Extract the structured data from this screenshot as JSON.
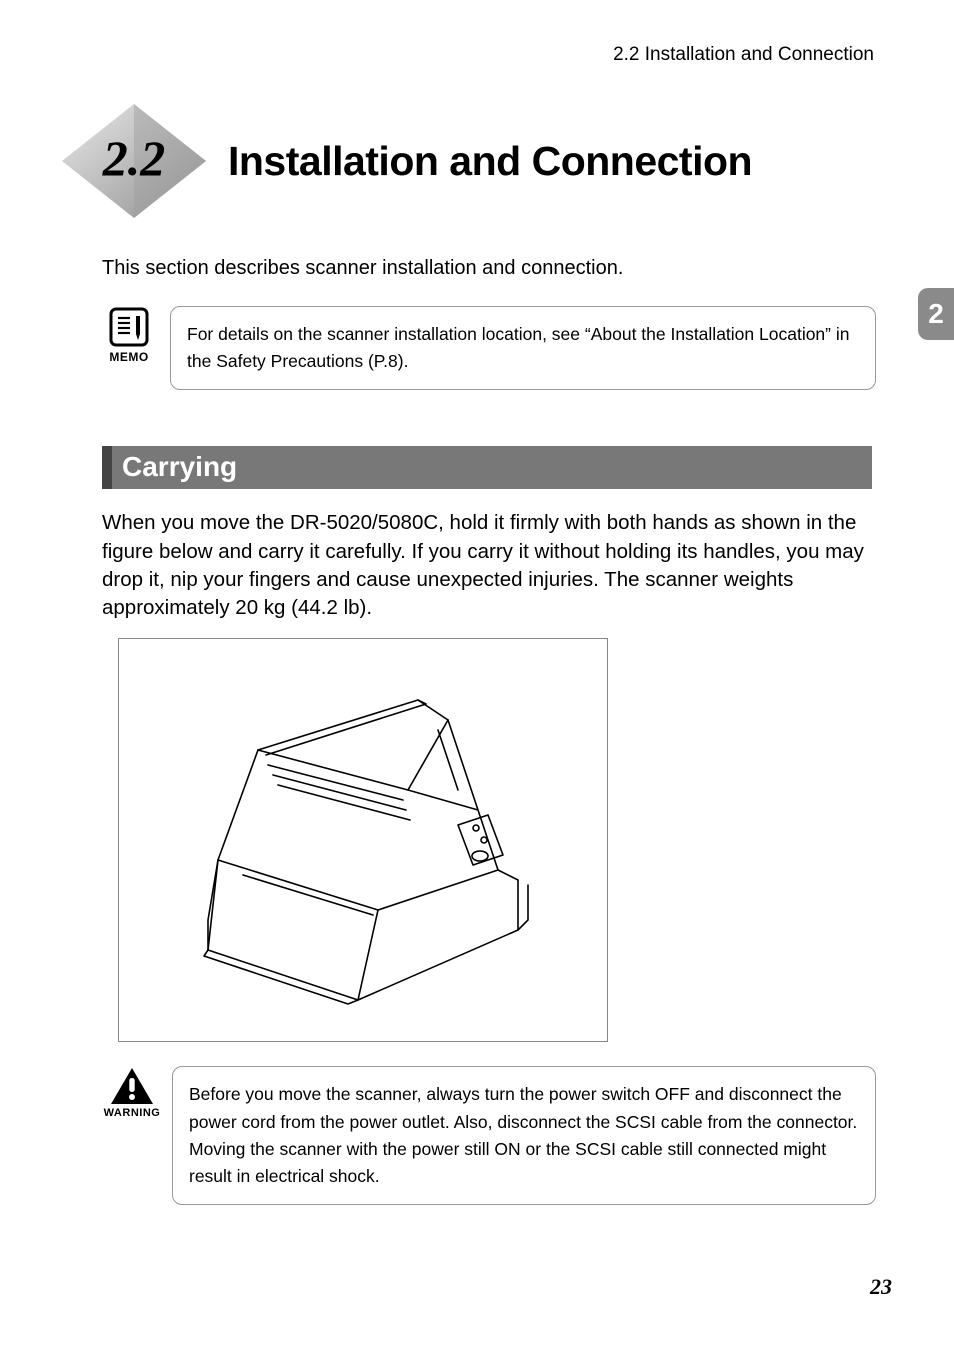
{
  "header": {
    "text": "2.2   Installation and Connection"
  },
  "chapter_tab": "2",
  "title": {
    "badge_number": "2.2",
    "text": "Installation and Connection"
  },
  "intro": "This section describes scanner installation and connection.",
  "memo": {
    "label": "MEMO",
    "text": "For details on the scanner installation location, see “About the Installation Location” in the Safety Precautions (P.8)."
  },
  "subheading": "Carrying",
  "body": "When you move the DR-5020/5080C, hold it firmly with both hands as shown in the figure below and carry it carefully. If you carry it without holding its handles, you may drop it, nip your fingers and cause unexpected injuries. The scanner weights approximately 20 kg (44.2 lb).",
  "warning": {
    "label": "WARNING",
    "text": "Before you move the scanner, always turn the power switch OFF and disconnect the power cord from the power outlet. Also, disconnect the SCSI cable from the connector. Moving the scanner with the power still ON or the SCSI cable still connected might result in electrical shock."
  },
  "page_number": "23"
}
